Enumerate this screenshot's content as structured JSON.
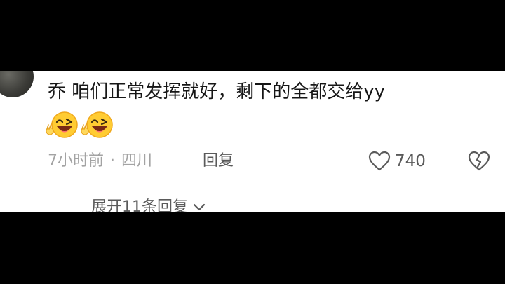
{
  "comment": {
    "text": "乔 咱们正常发挥就好，剩下的全都交给yy",
    "emojis": [
      "laughing-wink-emoji",
      "laughing-wink-emoji"
    ],
    "time": "7小时前",
    "separator": "·",
    "location": "四川",
    "reply_label": "回复",
    "like_count": "740"
  },
  "replies": {
    "expand_label": "展开11条回复"
  },
  "colors": {
    "text": "#161616",
    "meta": "#a3a3a3",
    "action": "#5a5a5a",
    "emoji_face": "#ffcc33",
    "background": "#ffffff",
    "letterbox": "#000000"
  }
}
